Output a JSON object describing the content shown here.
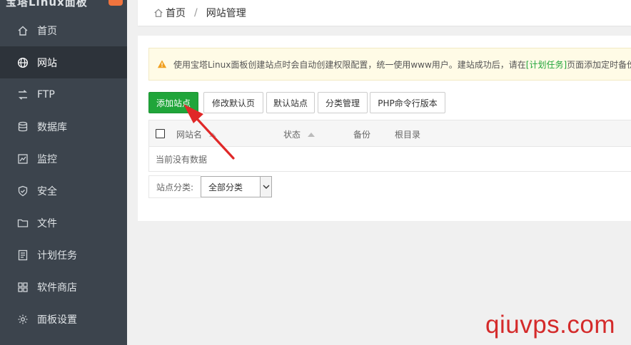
{
  "sidebar": {
    "logo_text": "宝塔Linux面板",
    "items": [
      {
        "label": "首页",
        "icon": "home-icon"
      },
      {
        "label": "网站",
        "icon": "globe-icon",
        "active": true
      },
      {
        "label": "FTP",
        "icon": "ftp-icon"
      },
      {
        "label": "数据库",
        "icon": "database-icon"
      },
      {
        "label": "监控",
        "icon": "monitor-icon"
      },
      {
        "label": "安全",
        "icon": "shield-icon"
      },
      {
        "label": "文件",
        "icon": "folder-icon"
      },
      {
        "label": "计划任务",
        "icon": "list-icon"
      },
      {
        "label": "软件商店",
        "icon": "grid-icon"
      },
      {
        "label": "面板设置",
        "icon": "gear-icon"
      }
    ]
  },
  "breadcrumb": {
    "home": "首页",
    "separator": "/",
    "current": "网站管理"
  },
  "notice": {
    "text_before": "使用宝塔Linux面板创建站点时会自动创建权限配置，统一使用www用户。建站成功后，请在",
    "link": "[计划任务]",
    "text_after": "页面添加定时备份"
  },
  "toolbar": {
    "add_site": "添加站点",
    "edit_default_page": "修改默认页",
    "default_site": "默认站点",
    "category_manage": "分类管理",
    "php_cli_version": "PHP命令行版本"
  },
  "table": {
    "columns": [
      "网站名",
      "状态",
      "备份",
      "根目录"
    ],
    "empty_text": "当前没有数据"
  },
  "filter": {
    "label": "站点分类:",
    "selected": "全部分类"
  },
  "watermark": "qiuvps.com",
  "colors": {
    "sidebar_bg": "#3c444d",
    "sidebar_active": "#2d333a",
    "primary_green": "#20a53a",
    "warning_orange": "#f0a020",
    "annotation_red": "#e02828"
  }
}
